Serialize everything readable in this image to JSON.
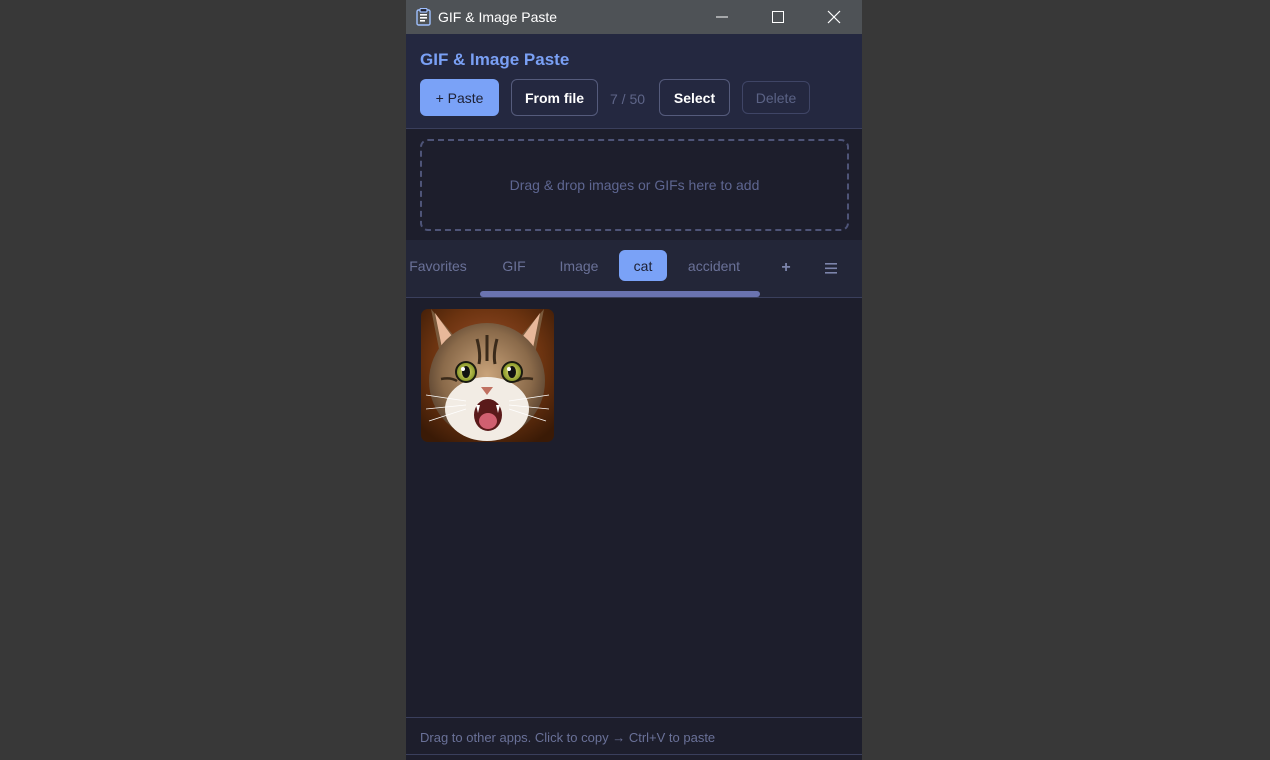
{
  "window": {
    "title": "GIF & Image Paste",
    "controls": {
      "minimize_icon": "minimize-icon",
      "maximize_icon": "maximize-icon",
      "close_icon": "close-icon"
    }
  },
  "header": {
    "title": "GIF & Image Paste",
    "paste_label": "+ Paste",
    "from_file_label": "From file",
    "counter": "7 / 50",
    "select_label": "Select",
    "delete_label": "Delete"
  },
  "dropzone": {
    "text": "Drag & drop images or GIFs here to add"
  },
  "tabs": {
    "items": [
      {
        "label": "Favorites",
        "active": false
      },
      {
        "label": "GIF",
        "active": false
      },
      {
        "label": "Image",
        "active": false
      },
      {
        "label": "cat",
        "active": true
      },
      {
        "label": "accident",
        "active": false
      }
    ],
    "add_label": "+",
    "menu_icon": "hamburger-menu-icon"
  },
  "content": {
    "items": [
      {
        "type": "image",
        "subject": "surprised tabby cat"
      }
    ]
  },
  "footer": {
    "text": "Drag to other apps. Click to copy → Ctrl+V to paste"
  },
  "colors": {
    "accent": "#7aa2f7",
    "background": "#1d1e2c",
    "header_bg": "#242840",
    "titlebar_bg": "#4e5256"
  }
}
